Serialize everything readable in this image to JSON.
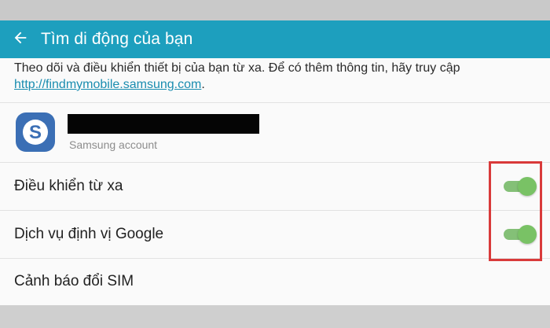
{
  "header": {
    "title": "Tìm di động của bạn",
    "back_icon": "arrow-left-icon",
    "color": "#1d9fbe"
  },
  "description": {
    "text": "Theo dõi và điều khiển thiết bị của bạn từ xa. Để có thêm thông tin, hãy truy cập",
    "link": "http://findmymobile.samsung.com",
    "suffix": "."
  },
  "account": {
    "icon": "samsung-account-icon",
    "label": "Samsung account"
  },
  "settings": [
    {
      "label": "Điều khiển từ xa",
      "toggle": true
    },
    {
      "label": "Dịch vụ định vị Google",
      "toggle": true
    },
    {
      "label": "Cảnh báo đổi SIM"
    }
  ],
  "colors": {
    "switch_on": "#79c265",
    "highlight_box": "#d93a3a"
  }
}
